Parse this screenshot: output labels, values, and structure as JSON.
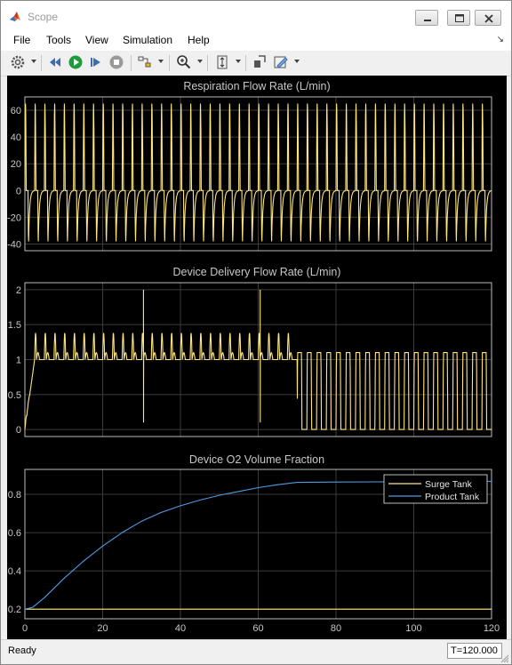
{
  "window": {
    "title": "Scope"
  },
  "menu": [
    "File",
    "Tools",
    "View",
    "Simulation",
    "Help"
  ],
  "toolbar": {
    "icons": [
      "settings-icon",
      "step-back-icon",
      "run-icon",
      "step-forward-icon",
      "stop-icon",
      "signal-selector-icon",
      "zoom-icon",
      "autoscale-icon",
      "highlight-block-icon",
      "style-icon"
    ]
  },
  "status": {
    "text": "Ready",
    "time": "T=120.000"
  },
  "colors": {
    "surge": "#ffe680",
    "product": "#4d9be6",
    "grid": "#3c3c3c",
    "axis": "#c8c8c8",
    "background": "#000000"
  },
  "chart_data": [
    {
      "type": "line",
      "title": "Respiration Flow Rate (L/min)",
      "xlim": [
        0,
        120
      ],
      "ylim": [
        -45,
        70
      ],
      "yticks": [
        -40,
        -20,
        0,
        20,
        40,
        60
      ],
      "xticks": [
        0,
        20,
        40,
        60,
        80,
        100,
        120
      ],
      "show_x_ticklabels": false,
      "grid": true,
      "series": [
        {
          "color": "#ffe680",
          "breath_period": 2.5,
          "peak": 65,
          "trough": -38,
          "baseline": 0
        }
      ]
    },
    {
      "type": "line",
      "title": "Device Delivery Flow Rate (L/min)",
      "xlim": [
        0,
        120
      ],
      "ylim": [
        -0.1,
        2.1
      ],
      "yticks": [
        0,
        0.5,
        1,
        1.5,
        2
      ],
      "xticks": [
        0,
        20,
        40,
        60,
        80,
        100,
        120
      ],
      "show_x_ticklabels": false,
      "grid": true,
      "series": [
        {
          "color": "#ffe680",
          "pulse_period": 2.5,
          "pulse_peak_phase1": 1.38,
          "baseline_phase1": 1.0,
          "phase_switch_x": 70,
          "pulse_peak_phase2": 1.1,
          "baseline_phase2": 0.0,
          "spikes": [
            {
              "x": 30.5,
              "high": 2.0,
              "low": 0.1
            },
            {
              "x": 60.5,
              "high": 2.0,
              "low": 0.1
            }
          ]
        }
      ]
    },
    {
      "type": "line",
      "title": "Device O2 Volume Fraction",
      "xlim": [
        0,
        120
      ],
      "ylim": [
        0.15,
        0.93
      ],
      "yticks": [
        0.2,
        0.4,
        0.6,
        0.8
      ],
      "xticks": [
        0,
        20,
        40,
        60,
        80,
        100,
        120
      ],
      "show_x_ticklabels": true,
      "grid": true,
      "legend": "top-right",
      "series": [
        {
          "name": "Surge Tank",
          "color": "#ffe680",
          "x": [
            0,
            120
          ],
          "y": [
            0.2,
            0.2
          ]
        },
        {
          "name": "Product Tank",
          "color": "#4d9be6",
          "x": [
            0,
            2,
            5,
            10,
            15,
            20,
            25,
            30,
            35,
            40,
            45,
            50,
            55,
            60,
            65,
            70,
            80,
            90,
            100,
            110,
            120
          ],
          "y": [
            0.2,
            0.21,
            0.26,
            0.36,
            0.45,
            0.53,
            0.6,
            0.66,
            0.705,
            0.74,
            0.77,
            0.795,
            0.815,
            0.835,
            0.85,
            0.862,
            0.864,
            0.865,
            0.866,
            0.867,
            0.868
          ]
        }
      ]
    }
  ]
}
